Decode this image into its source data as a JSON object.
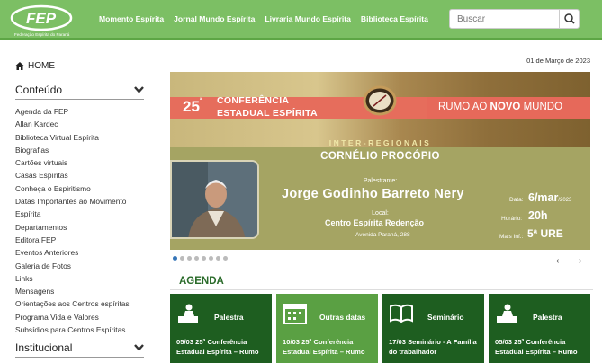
{
  "header": {
    "logo_text": "FEP",
    "logo_sub": "Federação Espírita do Paraná",
    "nav": [
      "Momento Espírita",
      "Jornal Mundo Espírita",
      "Livraria Mundo Espírita",
      "Biblioteca Espírita"
    ],
    "search_placeholder": "Buscar"
  },
  "sidebar": {
    "home_label": "HOME",
    "section1": "Conteúdo",
    "items": [
      "Agenda da FEP",
      "Allan Kardec",
      "Biblioteca Virtual Espírita",
      "Biografias",
      "Cartões virtuais",
      "Casas Espíritas",
      "Conheça o Espiritismo",
      "Datas Importantes ao Movimento",
      "Espírita",
      "Departamentos",
      "Editora FEP",
      "Eventos Anteriores",
      "Galeria de Fotos",
      "Links",
      "Mensagens",
      "Orientações aos Centros espíritas",
      "Programa Vida e Valores",
      "Subsídios para Centros Espíritas"
    ],
    "section2": "Institucional"
  },
  "date": "01 de Março de 2023",
  "banner": {
    "num": "25",
    "num_sup": "ª",
    "conf_line1": "CONFERÊNCIA",
    "conf_line2": "ESTADUAL ESPÍRITA",
    "rumo_pre": "RUMO AO ",
    "rumo_bold": "NOVO",
    "rumo_post": " MUNDO",
    "inter": "INTER-REGIONAIS",
    "city": "CORNÉLIO PROCÓPIO",
    "palestrante_label": "Palestrante:",
    "speaker": "Jorge Godinho Barreto Nery",
    "local_label": "Local:",
    "centro": "Centro Espírita Redenção",
    "avenida": "Avenida Paraná, 288",
    "data_label": "Data:",
    "data_value": "6/mar",
    "data_year": "/2023",
    "horario_label": "Horário:",
    "horario_value": "20h",
    "mais_label": "Mais Inf.:",
    "mais_value": "5ª URE"
  },
  "carousel": {
    "dots": 8,
    "active": 0,
    "prev": "‹",
    "next": "›"
  },
  "agenda": {
    "title": "AGENDA",
    "cards": [
      {
        "type": "Palestra",
        "text": "05/03 25ª Conferência Estadual Espírita – Rumo",
        "icon": "speaker-icon",
        "color": "#1e5e20"
      },
      {
        "type": "Outras datas",
        "text": "10/03 25ª Conferência Estadual Espírita – Rumo",
        "icon": "calendar-icon",
        "color": "#5aa043"
      },
      {
        "type": "Seminário",
        "text": "17/03 Seminário - A Família do trabalhador",
        "icon": "book-icon",
        "color": "#1e5e20"
      },
      {
        "type": "Palestra",
        "text": "05/03 25ª Conferência Estadual Espírita – Rumo",
        "icon": "speaker-icon",
        "color": "#1e5e20"
      }
    ]
  }
}
